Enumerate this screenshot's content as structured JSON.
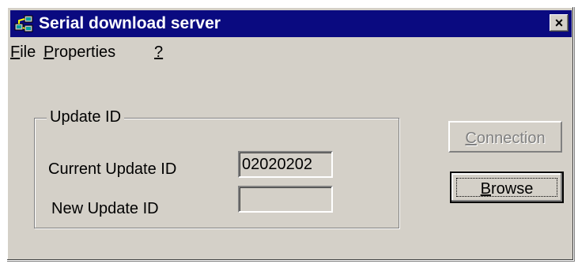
{
  "window": {
    "title": "Serial download server",
    "close_label": "×",
    "icon": "network-computers-icon"
  },
  "menu": {
    "items": [
      {
        "mnemonic": "F",
        "rest": "ile"
      },
      {
        "mnemonic": "P",
        "rest": "roperties"
      },
      {
        "mnemonic": "?",
        "rest": ""
      }
    ]
  },
  "update_group": {
    "label": "Update ID",
    "current_label": "Current Update ID",
    "current_value": "02020202",
    "new_label": "New Update ID",
    "new_value": ""
  },
  "buttons": {
    "connection": {
      "mnemonic": "C",
      "rest": "onnection",
      "enabled": false
    },
    "browse": {
      "mnemonic": "B",
      "rest": "rowse",
      "enabled": true
    }
  },
  "colors": {
    "face": "#d4d0c8",
    "titlebar": "#0a0a80"
  }
}
